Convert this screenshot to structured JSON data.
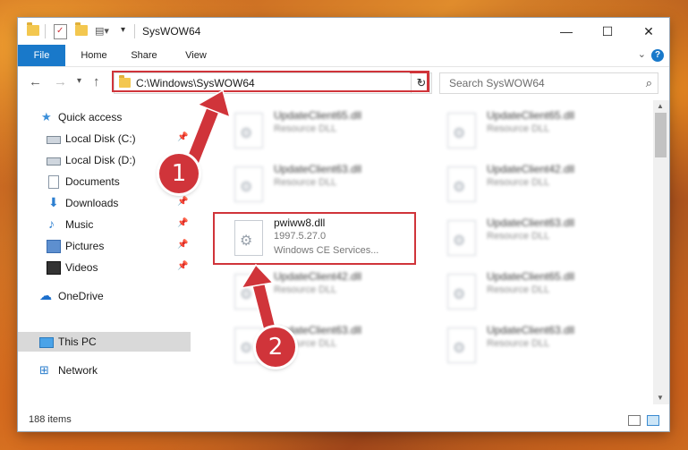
{
  "window": {
    "title": "SysWOW64"
  },
  "ribbon": {
    "tabs": [
      "File",
      "Home",
      "Share",
      "View"
    ],
    "help": "?"
  },
  "address": {
    "path": "C:\\Windows\\SysWOW64"
  },
  "search": {
    "placeholder": "Search SysWOW64"
  },
  "nav": {
    "items": [
      {
        "label": "Quick access",
        "icon": "star-icon"
      },
      {
        "label": "Local Disk (C:)",
        "icon": "drive-icon",
        "pinned": true
      },
      {
        "label": "Local Disk (D:)",
        "icon": "drive-icon"
      },
      {
        "label": "Documents",
        "icon": "document-icon",
        "pinned": true
      },
      {
        "label": "Downloads",
        "icon": "download-icon",
        "pinned": true
      },
      {
        "label": "Music",
        "icon": "music-icon",
        "pinned": true
      },
      {
        "label": "Pictures",
        "icon": "picture-icon",
        "pinned": true
      },
      {
        "label": "Videos",
        "icon": "video-icon",
        "pinned": true
      },
      {
        "label": "OneDrive",
        "icon": "cloud-icon"
      },
      {
        "label": "This PC",
        "icon": "computer-icon",
        "selected": true
      },
      {
        "label": "Network",
        "icon": "network-icon"
      }
    ]
  },
  "files": [
    {
      "name": "UpdateClient65.dll",
      "type": "Resource DLL",
      "blurred": true
    },
    {
      "name": "UpdateClient65.dll",
      "type": "Resource DLL",
      "blurred": true
    },
    {
      "name": "UpdateClient63.dll",
      "type": "Resource DLL",
      "blurred": true
    },
    {
      "name": "UpdateClient42.dll",
      "type": "Resource DLL",
      "blurred": true
    },
    {
      "name": "pwiww8.dll",
      "version": "1997.5.27.0",
      "type": "Windows CE Services...",
      "blurred": false
    },
    {
      "name": "UpdateClient63.dll",
      "type": "Resource DLL",
      "blurred": true
    },
    {
      "name": "UpdateClient42.dll",
      "type": "Resource DLL",
      "blurred": true
    },
    {
      "name": "UpdateClient65.dll",
      "type": "Resource DLL",
      "blurred": true
    },
    {
      "name": "UpdateClient63.dll",
      "type": "Resource DLL",
      "blurred": true
    },
    {
      "name": "UpdateClient63.dll",
      "type": "Resource DLL",
      "blurred": true
    }
  ],
  "status": {
    "count": "188 items"
  },
  "callouts": [
    "1",
    "2"
  ],
  "colors": {
    "accent": "#1979ca",
    "highlight": "#d0343a"
  }
}
